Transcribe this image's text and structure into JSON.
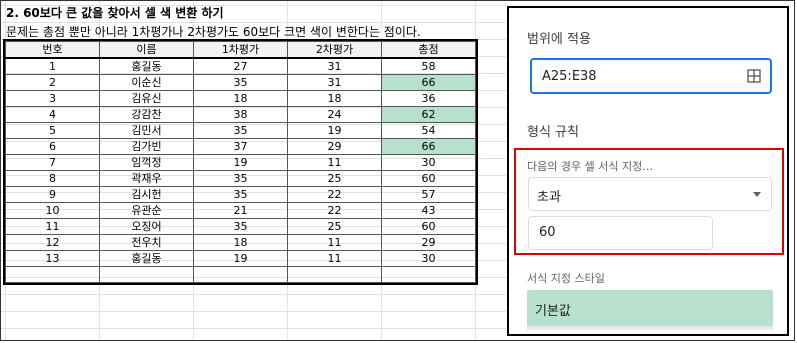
{
  "sheet": {
    "title": "2. 60보다 큰 값을 찾아서 셀 색 변환 하기",
    "description": "문제는 총점 뿐만 아니라 1차평가나 2차평가도 60보다 크면 색이 변한다는 점이다.",
    "headers": [
      "번호",
      "이름",
      "1차평가",
      "2차평가",
      "총점"
    ],
    "rows": [
      [
        "1",
        "홍길동",
        "27",
        "31",
        "58"
      ],
      [
        "2",
        "이순신",
        "35",
        "31",
        "66"
      ],
      [
        "3",
        "김유신",
        "18",
        "18",
        "36"
      ],
      [
        "4",
        "강감찬",
        "38",
        "24",
        "62"
      ],
      [
        "5",
        "김민서",
        "35",
        "19",
        "54"
      ],
      [
        "6",
        "김가빈",
        "37",
        "29",
        "66"
      ],
      [
        "7",
        "임꺽정",
        "19",
        "11",
        "30"
      ],
      [
        "8",
        "곽재우",
        "35",
        "25",
        "60"
      ],
      [
        "9",
        "김시헌",
        "35",
        "22",
        "57"
      ],
      [
        "10",
        "유관순",
        "21",
        "22",
        "43"
      ],
      [
        "11",
        "오징어",
        "35",
        "25",
        "60"
      ],
      [
        "12",
        "전우치",
        "18",
        "11",
        "29"
      ],
      [
        "13",
        "홍길동",
        "19",
        "11",
        "30"
      ]
    ],
    "highlight_color": "#b7e1cd"
  },
  "panel": {
    "apply_range_label": "범위에 적용",
    "range_value": "A25:E38",
    "range_icon": "grid-icon",
    "format_rules_label": "형식 규칙",
    "condition_label": "다음의 경우 셀 서식 지정…",
    "condition_value": "초과",
    "threshold_value": "60",
    "style_label": "서식 지정 스타일",
    "style_value": "기본값"
  }
}
